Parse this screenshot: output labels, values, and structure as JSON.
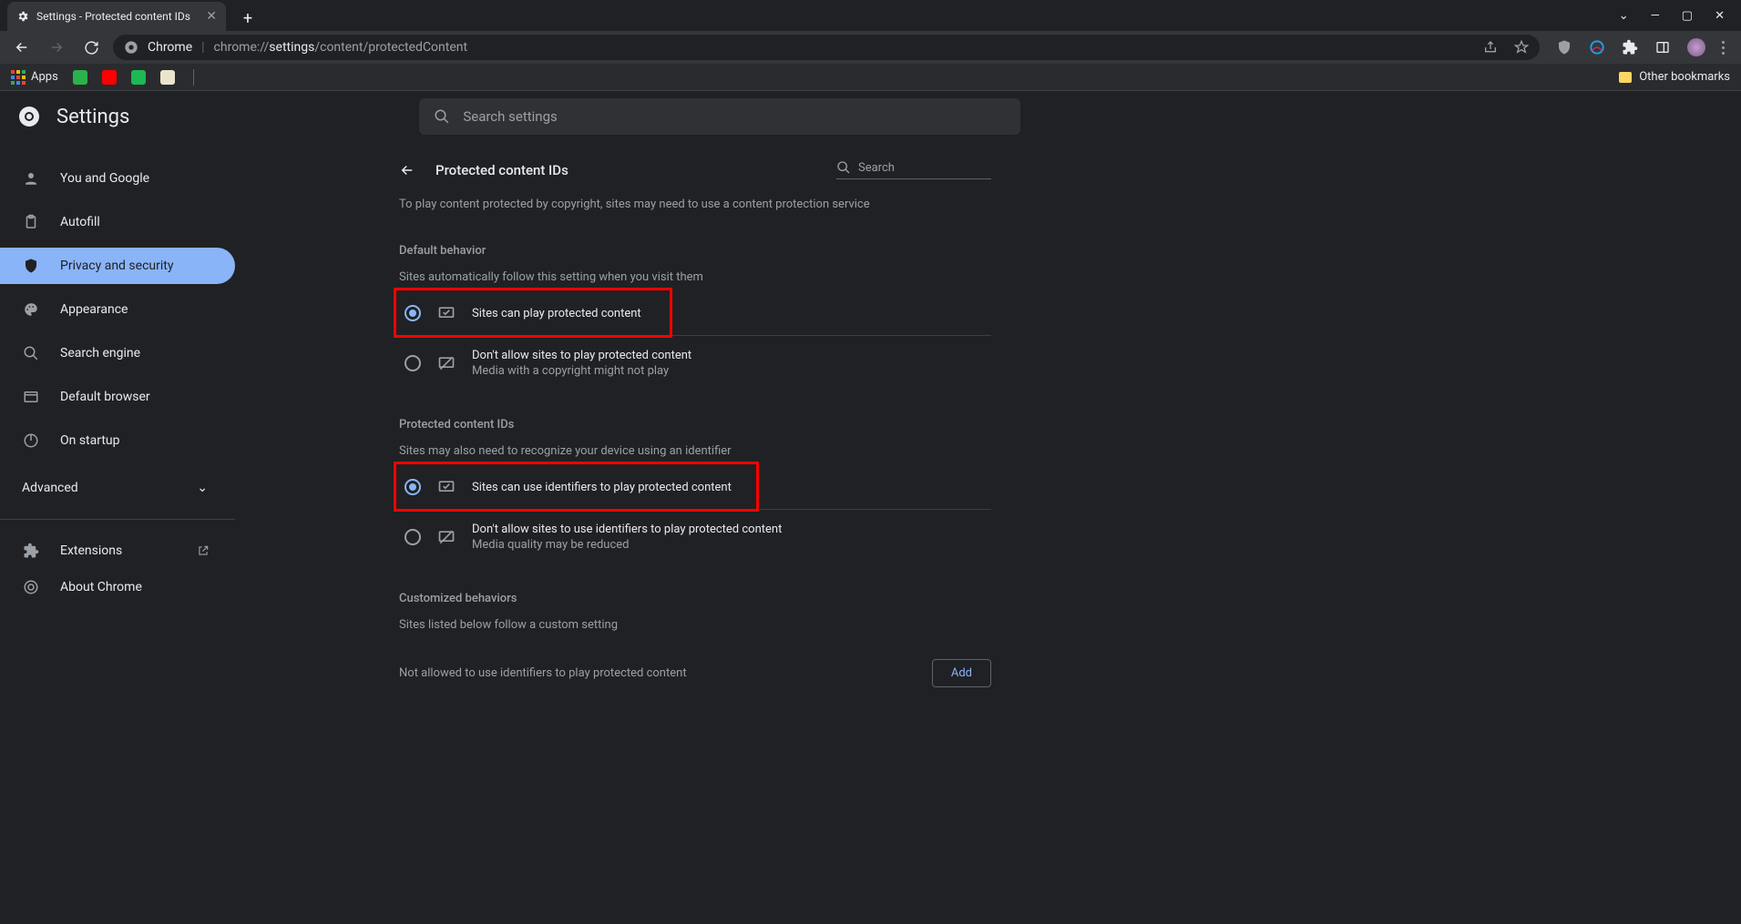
{
  "browser": {
    "tab_title": "Settings - Protected content IDs",
    "omnibox_label": "Chrome",
    "omnibox_url_prefix": "chrome://",
    "omnibox_url_mid": "settings",
    "omnibox_url_suffix": "/content/protectedContent",
    "apps_label": "Apps",
    "other_bookmarks": "Other bookmarks"
  },
  "header": {
    "title": "Settings",
    "search_placeholder": "Search settings"
  },
  "sidebar": {
    "items": [
      {
        "label": "You and Google"
      },
      {
        "label": "Autofill"
      },
      {
        "label": "Privacy and security"
      },
      {
        "label": "Appearance"
      },
      {
        "label": "Search engine"
      },
      {
        "label": "Default browser"
      },
      {
        "label": "On startup"
      }
    ],
    "advanced": "Advanced",
    "extensions": "Extensions",
    "about": "About Chrome"
  },
  "panel": {
    "title": "Protected content IDs",
    "search_placeholder": "Search",
    "intro": "To play content protected by copyright, sites may need to use a content protection service",
    "default_behavior_title": "Default behavior",
    "default_behavior_sub": "Sites automatically follow this setting when you visit them",
    "opt_play": "Sites can play protected content",
    "opt_block": "Don't allow sites to play protected content",
    "opt_block_sub": "Media with a copyright might not play",
    "ids_title": "Protected content IDs",
    "ids_sub": "Sites may also need to recognize your device using an identifier",
    "opt_ids_allow": "Sites can use identifiers to play protected content",
    "opt_ids_block": "Don't allow sites to use identifiers to play protected content",
    "opt_ids_block_sub": "Media quality may be reduced",
    "custom_title": "Customized behaviors",
    "custom_sub": "Sites listed below follow a custom setting",
    "not_allowed": "Not allowed to use identifiers to play protected content",
    "add": "Add"
  }
}
